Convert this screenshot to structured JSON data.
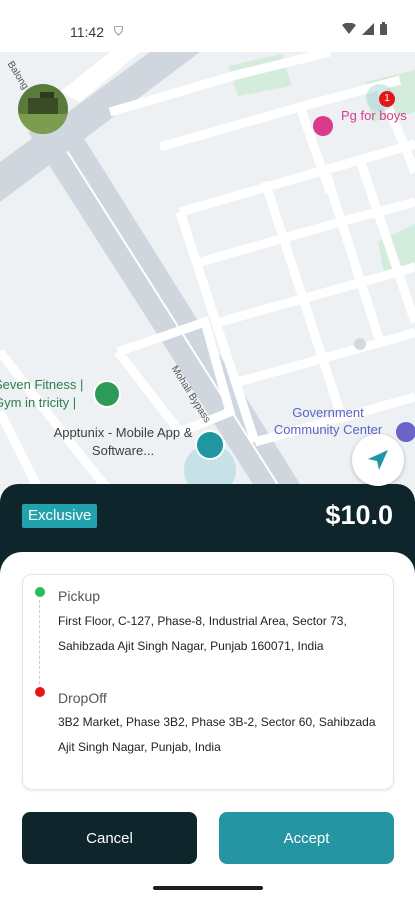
{
  "status_bar": {
    "time": "11:42",
    "left_icon": "shield-icon",
    "right_icons": [
      "wifi-icon",
      "signal-icon",
      "battery-icon"
    ]
  },
  "map": {
    "labels": {
      "road_left": "Balong",
      "bypass": "Mohali Bypass",
      "pg": "Pg for boys",
      "fitness": "Seven Fitness | Gym in tricity |",
      "apptunix": "Apptunix - Mobile App & Software...",
      "government": "Government Community Center"
    },
    "pg_badge_count": "1"
  },
  "sheet": {
    "badge": "Exclusive",
    "price": "$10.0"
  },
  "route": {
    "pickup_label": "Pickup",
    "pickup_address": "First Floor, C-127, Phase-8, Industrial Area, Sector 73, Sahibzada Ajit Singh Nagar, Punjab 160071, India",
    "dropoff_label": "DropOff",
    "dropoff_address": "3B2 Market, Phase 3B2, Phase 3B-2, Sector 60, Sahibzada Ajit Singh Nagar, Punjab, India"
  },
  "actions": {
    "cancel": "Cancel",
    "accept": "Accept"
  },
  "colors": {
    "sheet_dark": "#0e262b",
    "accent_teal": "#22a2ad",
    "accept_btn": "#2595a4",
    "pickup_dot": "#23c05a",
    "dropoff_dot": "#e51616"
  }
}
